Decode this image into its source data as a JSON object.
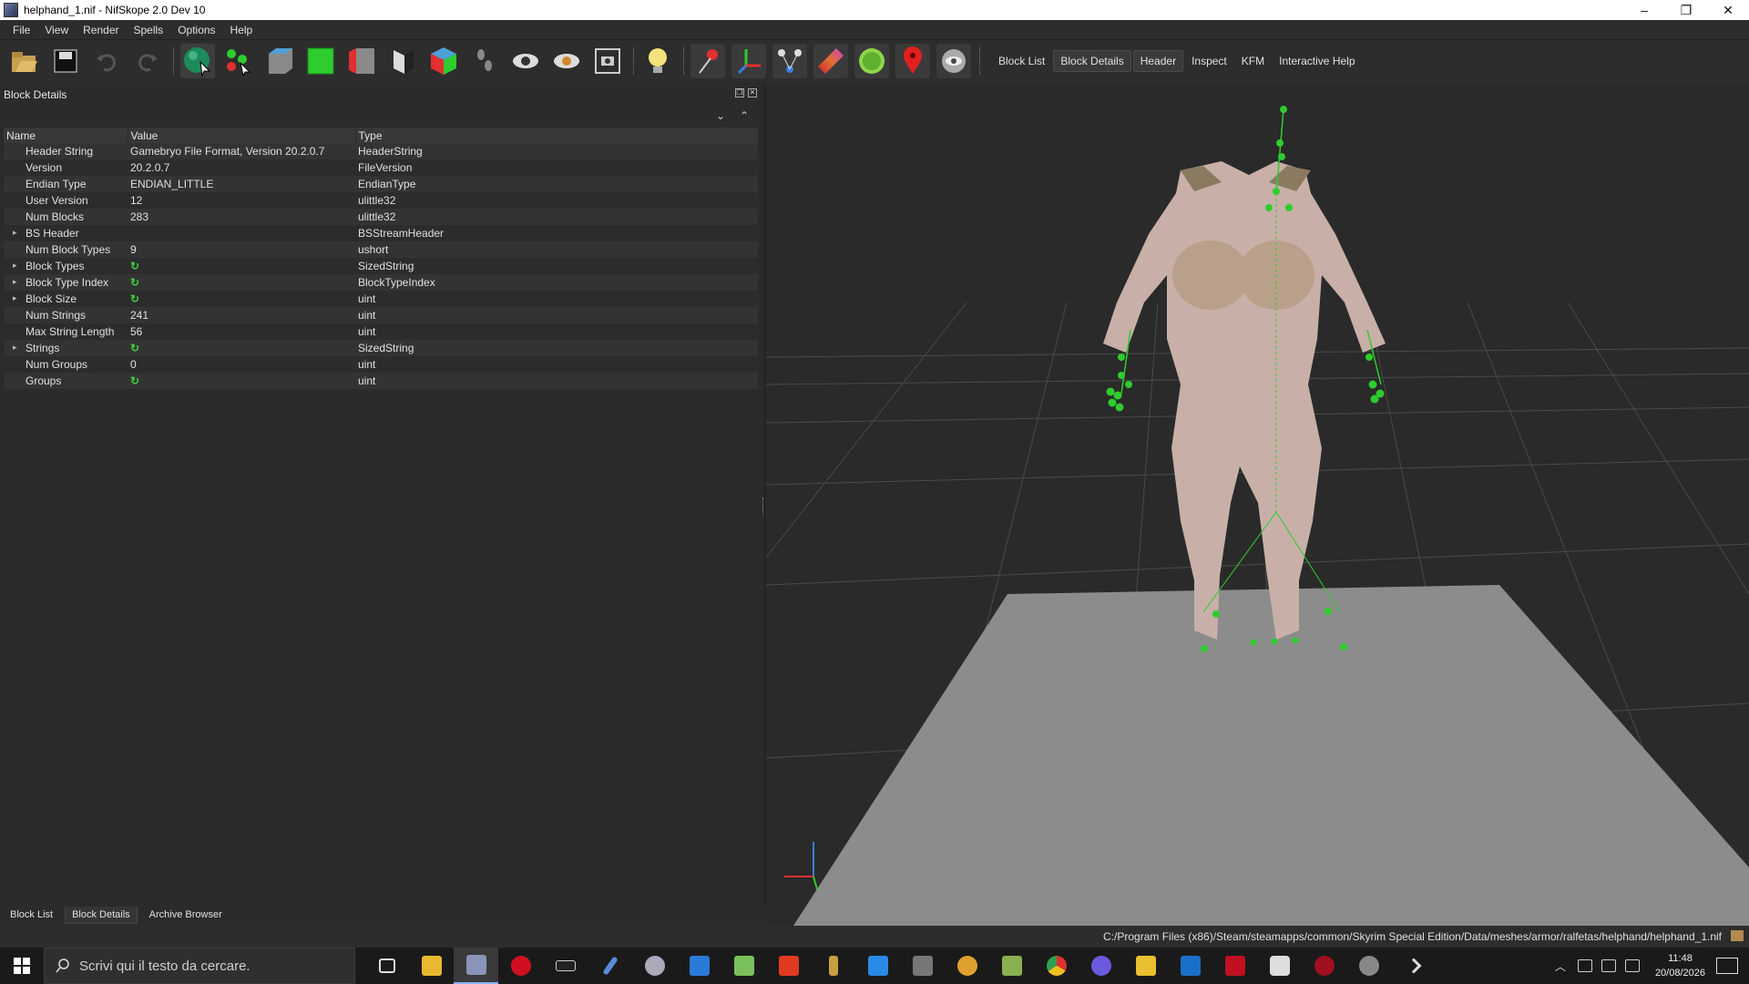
{
  "window": {
    "title": "helphand_1.nif - NifSkope 2.0 Dev 10",
    "minimize": "–",
    "restore": "❐",
    "close": "✕"
  },
  "menu": [
    "File",
    "View",
    "Render",
    "Spells",
    "Options",
    "Help"
  ],
  "toolbar": {
    "icons": [
      "open-icon",
      "save-icon",
      "undo-icon",
      "redo-icon",
      "select-object-icon",
      "select-vertex-icon",
      "view-top-icon",
      "view-front-icon",
      "view-side-icon",
      "view-walk-icon",
      "view-user-icon",
      "footsteps-icon",
      "eye-icon",
      "eye-hidden-icon",
      "screenshot-icon",
      "lightbulb-icon",
      "pin-icon",
      "axes-icon",
      "nodes-icon",
      "gradient-icon",
      "green-disc-icon",
      "marker-icon",
      "visibility-icon"
    ],
    "links": [
      "Block List",
      "Block Details",
      "Header",
      "Inspect",
      "KFM",
      "Interactive Help"
    ],
    "active_link": "Block Details"
  },
  "panel": {
    "title": "Block Details",
    "columns": [
      "Name",
      "Value",
      "Type"
    ],
    "rows": [
      {
        "name": "Header String",
        "value": "Gamebryo File Format, Version 20.2.0.7",
        "type": "HeaderString",
        "expandable": false,
        "refresh": false
      },
      {
        "name": "Version",
        "value": "20.2.0.7",
        "type": "FileVersion",
        "expandable": false,
        "refresh": false
      },
      {
        "name": "Endian Type",
        "value": "ENDIAN_LITTLE",
        "type": "EndianType",
        "expandable": false,
        "refresh": false
      },
      {
        "name": "User Version",
        "value": "12",
        "type": "ulittle32",
        "expandable": false,
        "refresh": false
      },
      {
        "name": "Num Blocks",
        "value": "283",
        "type": "ulittle32",
        "expandable": false,
        "refresh": false
      },
      {
        "name": "BS Header",
        "value": "",
        "type": "BSStreamHeader",
        "expandable": true,
        "refresh": false
      },
      {
        "name": "Num Block Types",
        "value": "9",
        "type": "ushort",
        "expandable": false,
        "refresh": false
      },
      {
        "name": "Block Types",
        "value": "",
        "type": "SizedString",
        "expandable": true,
        "refresh": true
      },
      {
        "name": "Block Type Index",
        "value": "",
        "type": "BlockTypeIndex",
        "expandable": true,
        "refresh": true
      },
      {
        "name": "Block Size",
        "value": "",
        "type": "uint",
        "expandable": true,
        "refresh": true
      },
      {
        "name": "Num Strings",
        "value": "241",
        "type": "uint",
        "expandable": false,
        "refresh": false
      },
      {
        "name": "Max String Length",
        "value": "56",
        "type": "uint",
        "expandable": false,
        "refresh": false
      },
      {
        "name": "Strings",
        "value": "",
        "type": "SizedString",
        "expandable": true,
        "refresh": true
      },
      {
        "name": "Num Groups",
        "value": "0",
        "type": "uint",
        "expandable": false,
        "refresh": false
      },
      {
        "name": "Groups",
        "value": "",
        "type": "uint",
        "expandable": false,
        "refresh": true
      }
    ]
  },
  "bottom_tabs": [
    "Block List",
    "Block Details",
    "Archive Browser"
  ],
  "active_bottom_tab": "Block Details",
  "status": {
    "path": "C:/Program Files (x86)/Steam/steamapps/common/Skyrim Special Edition/Data/meshes/armor/ralfetas/helphand/helphand_1.nif"
  },
  "taskbar": {
    "search_placeholder": "Scrivi qui il testo da cercare.",
    "apps": [
      "task-view",
      "file-explorer",
      "nifskope",
      "opera",
      "terminal",
      "pen-tool",
      "app-circle",
      "window-app",
      "notepad-app",
      "red-f-app",
      "arrow-app",
      "blue-window-app",
      "chart-app",
      "bird-app",
      "map-app",
      "chrome",
      "messenger",
      "folder-app",
      "blue-app",
      "red-app",
      "gear-app",
      "red-circle-app",
      "disc-app",
      "chevron-app"
    ],
    "time": "11:48",
    "date": "20/08/2026"
  },
  "colors": {
    "accent_green": "#2ecc2e",
    "panel_bg": "#2b2b2b",
    "viewport_bg": "#2a2a2a",
    "floor": "#8c8c8c"
  }
}
